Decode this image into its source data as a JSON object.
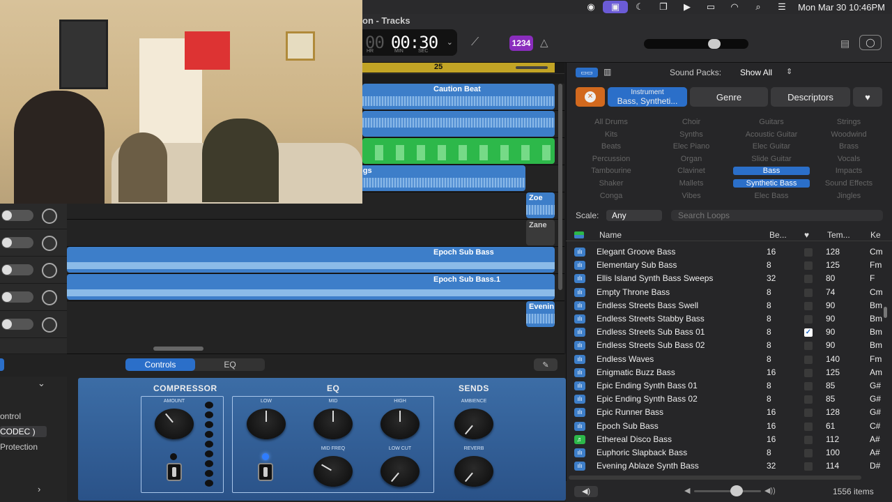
{
  "menubar": {
    "icons": [
      "record-icon",
      "screen-share-icon",
      "moon-icon",
      "mirroring-icon",
      "play-circle-icon",
      "battery-icon",
      "wifi-icon",
      "search-icon",
      "control-center-icon"
    ],
    "clock": "Mon Mar 30  10:46PM"
  },
  "window": {
    "title": "on - Tracks"
  },
  "lcd": {
    "time": "00:30",
    "dim": "00",
    "hr": "HR",
    "min": "MIN",
    "sec": "SEC"
  },
  "toolbar": {
    "count_in": "1234"
  },
  "ruler": {
    "bar": "25"
  },
  "regions": {
    "caution": "Caution Beat",
    "ngs": "ngs",
    "zoe": "Zoe",
    "zane": "Zane",
    "epoch": "Epoch Sub Bass",
    "epoch1": "Epoch Sub Bass.1",
    "even": "Evenin"
  },
  "editor": {
    "tab_controls": "Controls",
    "tab_eq": "EQ",
    "left_control": "ontrol",
    "left_codec": "CODEC )",
    "left_protection": "Protection",
    "compressor": "COMPRESSOR",
    "eq": "EQ",
    "sends": "SENDS",
    "amount": "AMOUNT",
    "low": "LOW",
    "mid": "MID",
    "high": "HIGH",
    "mid_freq": "MID FREQ",
    "low_cut": "LOW CUT",
    "ambience": "AMBIENCE",
    "reverb": "REVERB"
  },
  "browser": {
    "sound_packs_label": "Sound Packs:",
    "sound_packs_value": "Show All",
    "instrument_label": "Instrument",
    "instrument_value": "Bass, Syntheti...",
    "genre": "Genre",
    "descriptors": "Descriptors",
    "keywords": [
      [
        "All Drums",
        "Choir",
        "Guitars",
        "Strings"
      ],
      [
        "Kits",
        "Synths",
        "Acoustic Guitar",
        "Woodwind"
      ],
      [
        "Beats",
        "Elec Piano",
        "Elec Guitar",
        "Brass"
      ],
      [
        "Percussion",
        "Organ",
        "Slide Guitar",
        "Vocals"
      ],
      [
        "Tambourine",
        "Clavinet",
        "Bass",
        "Impacts"
      ],
      [
        "Shaker",
        "Mallets",
        "Synthetic Bass",
        "Sound Effects"
      ],
      [
        "Conga",
        "Vibes",
        "Elec Bass",
        "Jingles"
      ]
    ],
    "scale_label": "Scale:",
    "scale_value": "Any",
    "search_placeholder": "Search Loops",
    "col_name": "Name",
    "col_beats": "Be...",
    "col_tempo": "Tem...",
    "col_key": "Ke",
    "rows": [
      {
        "name": "Elegant Groove Bass",
        "beats": "16",
        "fav": false,
        "tempo": "128",
        "key": "Cm"
      },
      {
        "name": "Elementary Sub Bass",
        "beats": "8",
        "fav": false,
        "tempo": "125",
        "key": "Fm"
      },
      {
        "name": "Ellis Island Synth Bass Sweeps",
        "beats": "32",
        "fav": false,
        "tempo": "80",
        "key": "F"
      },
      {
        "name": "Empty Throne Bass",
        "beats": "8",
        "fav": false,
        "tempo": "74",
        "key": "Cm"
      },
      {
        "name": "Endless Streets Bass Swell",
        "beats": "8",
        "fav": false,
        "tempo": "90",
        "key": "Bm"
      },
      {
        "name": "Endless Streets Stabby Bass",
        "beats": "8",
        "fav": false,
        "tempo": "90",
        "key": "Bm"
      },
      {
        "name": "Endless Streets Sub Bass 01",
        "beats": "8",
        "fav": true,
        "tempo": "90",
        "key": "Bm"
      },
      {
        "name": "Endless Streets Sub Bass 02",
        "beats": "8",
        "fav": false,
        "tempo": "90",
        "key": "Bm"
      },
      {
        "name": "Endless Waves",
        "beats": "8",
        "fav": false,
        "tempo": "140",
        "key": "Fm"
      },
      {
        "name": "Enigmatic Buzz Bass",
        "beats": "16",
        "fav": false,
        "tempo": "125",
        "key": "Am"
      },
      {
        "name": "Epic Ending Synth Bass 01",
        "beats": "8",
        "fav": false,
        "tempo": "85",
        "key": "G#"
      },
      {
        "name": "Epic Ending Synth Bass 02",
        "beats": "8",
        "fav": false,
        "tempo": "85",
        "key": "G#"
      },
      {
        "name": "Epic Runner Bass",
        "beats": "16",
        "fav": false,
        "tempo": "128",
        "key": "G#"
      },
      {
        "name": "Epoch Sub Bass",
        "beats": "16",
        "fav": false,
        "tempo": "61",
        "key": "C#"
      },
      {
        "name": "Ethereal Disco Bass",
        "beats": "16",
        "fav": false,
        "tempo": "112",
        "key": "A#",
        "midi": true
      },
      {
        "name": "Euphoric Slapback Bass",
        "beats": "8",
        "fav": false,
        "tempo": "100",
        "key": "A#"
      },
      {
        "name": "Evening Ablaze Synth Bass",
        "beats": "32",
        "fav": false,
        "tempo": "114",
        "key": "D#"
      }
    ],
    "item_count": "1556 items"
  }
}
